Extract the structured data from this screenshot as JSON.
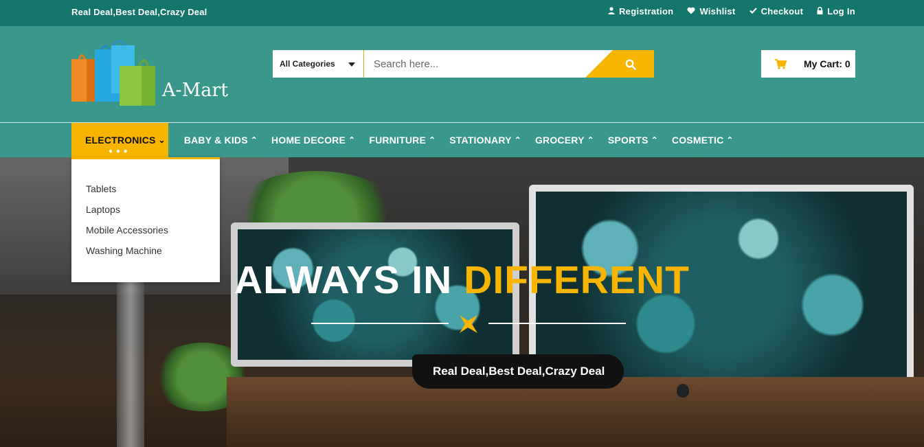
{
  "topbar": {
    "tagline": "Real Deal,Best Deal,Crazy Deal",
    "links": [
      {
        "label": "Registration",
        "icon": "user-icon"
      },
      {
        "label": "Wishlist",
        "icon": "heart-icon"
      },
      {
        "label": "Checkout",
        "icon": "check-icon"
      },
      {
        "label": "Log In",
        "icon": "lock-icon"
      }
    ]
  },
  "header": {
    "logo_text": "A-Mart",
    "search": {
      "category": "All Categories",
      "placeholder": "Search here..."
    },
    "cart": {
      "label": "My Cart: 0"
    }
  },
  "nav": {
    "items": [
      {
        "label": "ELECTRONICS",
        "active": true
      },
      {
        "label": "BABY & KIDS"
      },
      {
        "label": "HOME DECORE"
      },
      {
        "label": "FURNITURE"
      },
      {
        "label": "STATIONARY"
      },
      {
        "label": "GROCERY"
      },
      {
        "label": "SPORTS"
      },
      {
        "label": "COSMETIC"
      }
    ],
    "dropdown": [
      "Tablets",
      "Laptops",
      "Mobile Accessories",
      "Washing Machine"
    ]
  },
  "hero": {
    "title_part1": "ALWAYS IN",
    "title_part2": "DIFFERENT",
    "subtitle": "Real Deal,Best Deal,Crazy Deal"
  },
  "colors": {
    "topbar": "#14766d",
    "header": "#3a978c",
    "accent": "#f7b500"
  }
}
